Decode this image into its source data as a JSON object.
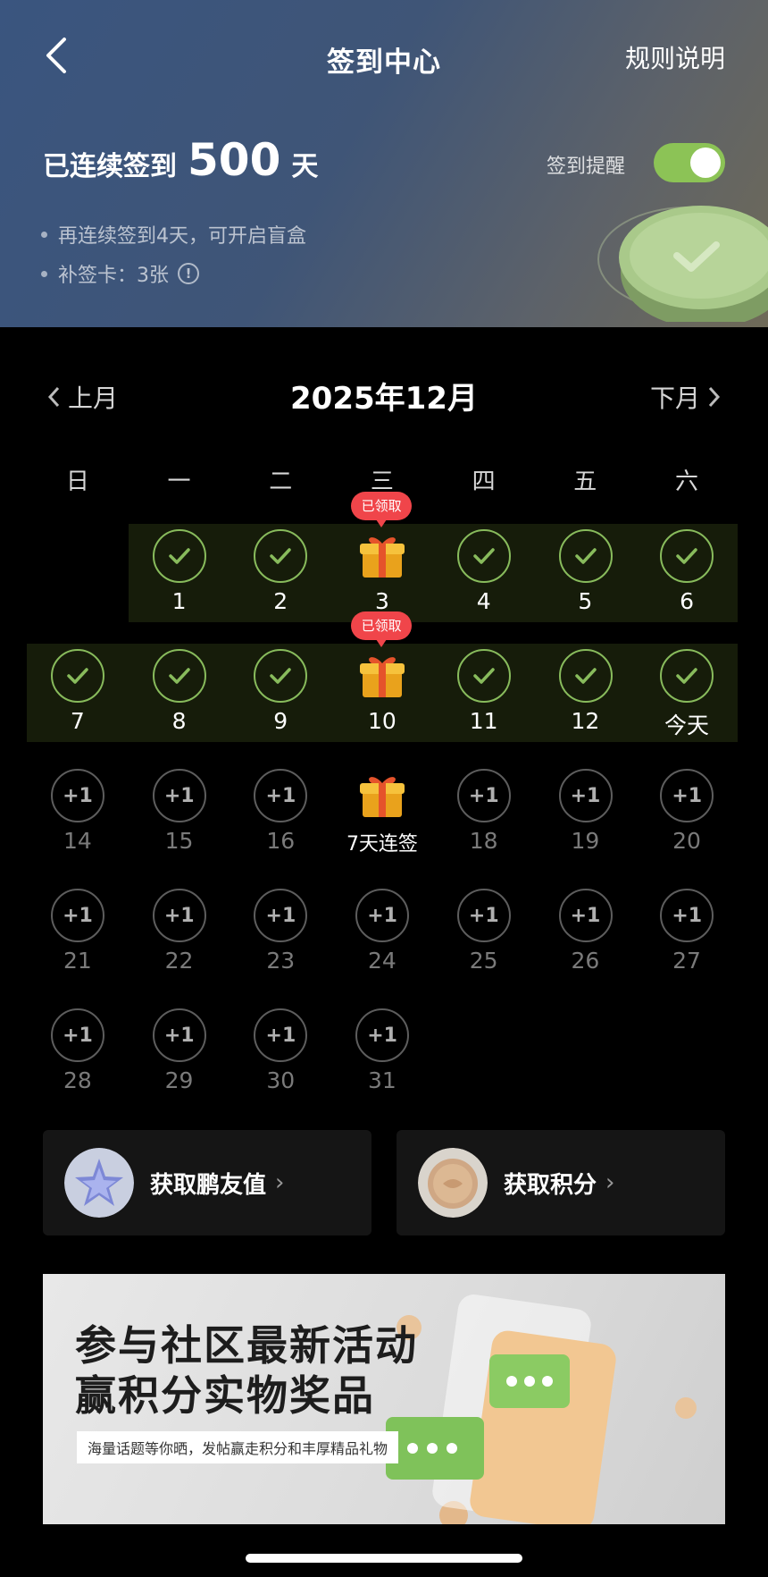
{
  "header": {
    "title": "签到中心",
    "rules_label": "规则说明",
    "streak_prefix": "已连续签到",
    "streak_days": "500",
    "streak_suffix": "天",
    "tips": [
      "再连续签到4天，可开启盲盒",
      "补签卡：3张"
    ],
    "reminder_label": "签到提醒",
    "reminder_on": true
  },
  "calendar": {
    "month_title": "2025年12月",
    "prev_label": "上月",
    "next_label": "下月",
    "weekdays": [
      "日",
      "一",
      "二",
      "三",
      "四",
      "五",
      "六"
    ],
    "claimed_badge": "已领取",
    "plus_label": "+1",
    "rows": [
      [
        null,
        {
          "label": "1",
          "state": "done"
        },
        {
          "label": "2",
          "state": "done"
        },
        {
          "label": "3",
          "state": "gift-claimed"
        },
        {
          "label": "4",
          "state": "done"
        },
        {
          "label": "5",
          "state": "done"
        },
        {
          "label": "6",
          "state": "done"
        }
      ],
      [
        {
          "label": "7",
          "state": "done"
        },
        {
          "label": "8",
          "state": "done"
        },
        {
          "label": "9",
          "state": "done"
        },
        {
          "label": "10",
          "state": "gift-claimed"
        },
        {
          "label": "11",
          "state": "done"
        },
        {
          "label": "12",
          "state": "done"
        },
        {
          "label": "今天",
          "state": "done"
        }
      ],
      [
        {
          "label": "14",
          "state": "future"
        },
        {
          "label": "15",
          "state": "future"
        },
        {
          "label": "16",
          "state": "future"
        },
        {
          "label": "7天连签",
          "state": "gift"
        },
        {
          "label": "18",
          "state": "future"
        },
        {
          "label": "19",
          "state": "future"
        },
        {
          "label": "20",
          "state": "future"
        }
      ],
      [
        {
          "label": "21",
          "state": "future"
        },
        {
          "label": "22",
          "state": "future"
        },
        {
          "label": "23",
          "state": "future"
        },
        {
          "label": "24",
          "state": "future"
        },
        {
          "label": "25",
          "state": "future"
        },
        {
          "label": "26",
          "state": "future"
        },
        {
          "label": "27",
          "state": "future"
        }
      ],
      [
        {
          "label": "28",
          "state": "future"
        },
        {
          "label": "29",
          "state": "future"
        },
        {
          "label": "30",
          "state": "future"
        },
        {
          "label": "31",
          "state": "future"
        },
        null,
        null,
        null
      ]
    ]
  },
  "cards": [
    {
      "label": "获取鹏友值",
      "icon": "star-badge-icon"
    },
    {
      "label": "获取积分",
      "icon": "coin-icon"
    }
  ],
  "banner": {
    "line1": "参与社区最新活动",
    "line2": "赢积分实物奖品",
    "subtitle": "海量话题等你晒，发帖赢走积分和丰厚精品礼物"
  },
  "colors": {
    "accent": "#8cc356",
    "done_ring": "#88bb5c",
    "badge": "#f0454a"
  }
}
